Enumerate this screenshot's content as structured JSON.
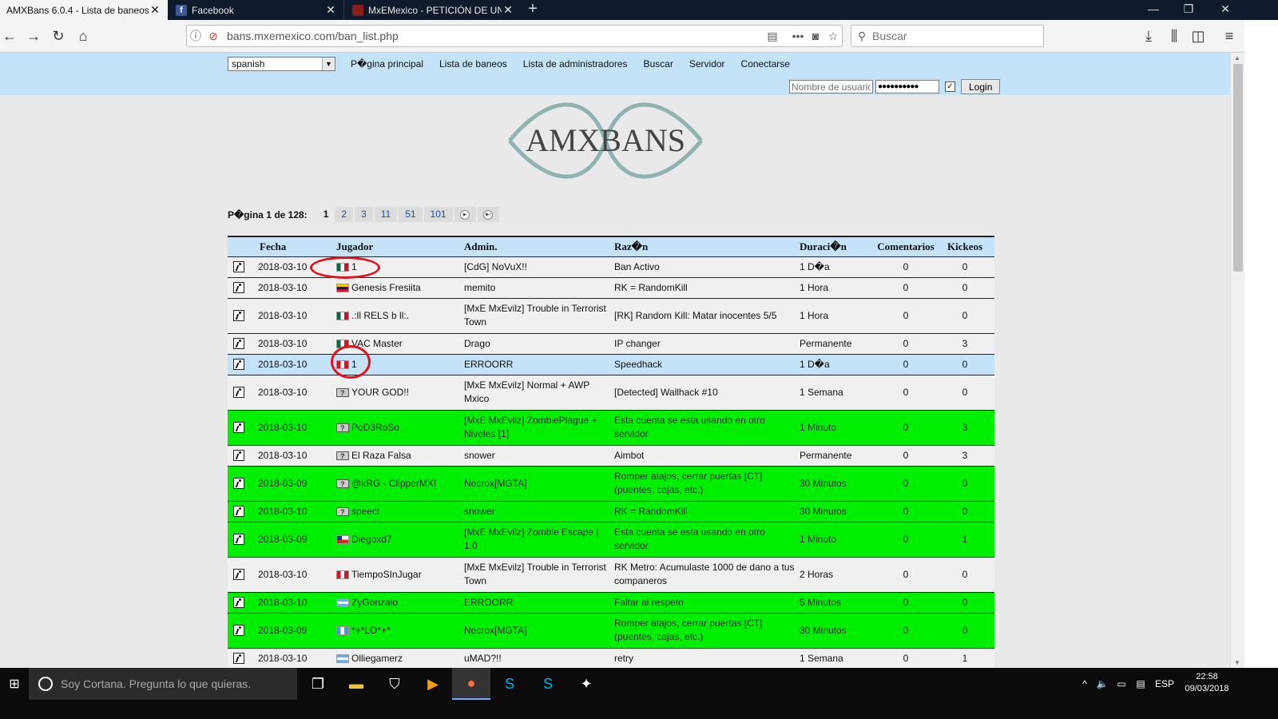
{
  "browser": {
    "tabs": [
      {
        "title": "AMXBans 6.0.4 - Lista de baneos",
        "active": true,
        "favicon": "amxbans-icon"
      },
      {
        "title": "Facebook",
        "active": false,
        "favicon": "facebook-icon"
      },
      {
        "title": "MxEMexico - PETICIÓN DE UNE",
        "active": false,
        "favicon": "mxemexico-icon"
      }
    ],
    "url": "bans.mxemexico.com/ban_list.php",
    "search_placeholder": "Buscar"
  },
  "site": {
    "language": "spanish",
    "menu": [
      "P�gina principal",
      "Lista de baneos",
      "Lista de administradores",
      "Buscar",
      "Servidor",
      "Conectarse"
    ],
    "login": {
      "username_placeholder": "Nombre de usuario",
      "password_mask": "●●●●●●●●●●",
      "button": "Login"
    },
    "logo_text": "AMXBANS"
  },
  "pager": {
    "label": "P�gina 1 de 128:",
    "current": "1",
    "pages": [
      "2",
      "3",
      "11",
      "51",
      "101"
    ],
    "next_icon": "next-page-icon",
    "last_icon": "last-page-icon"
  },
  "table": {
    "headers": [
      "Fecha",
      "Jugador",
      "Admin.",
      "Raz�n",
      "Duraci�n",
      "Comentarios",
      "Kickeos"
    ],
    "rows": [
      {
        "date": "2018-03-10",
        "flag": "mx",
        "player": "1",
        "admin": "[CdG] NoVuX!!",
        "reason": "Ban Activo",
        "duration": "1 D�a",
        "comments": "0",
        "kicks": "0",
        "style": "r"
      },
      {
        "date": "2018-03-10",
        "flag": "ve",
        "player": "Genesis Fresiita",
        "admin": "memito",
        "reason": "RK = RandomKill",
        "duration": "1 Hora",
        "comments": "0",
        "kicks": "0",
        "style": "r"
      },
      {
        "date": "2018-03-10",
        "flag": "mx",
        "player": ".:ll RELS b ll:.",
        "admin": "[MxE MxEvilz] Trouble in Terrorist Town",
        "reason": "[RK] Random Kill: Matar inocentes 5/5",
        "duration": "1 Hora",
        "comments": "0",
        "kicks": "0",
        "style": "r"
      },
      {
        "date": "2018-03-10",
        "flag": "mx",
        "player": "VAC Master",
        "admin": "Drago",
        "reason": "IP changer",
        "duration": "Permanente",
        "comments": "0",
        "kicks": "3",
        "style": "r"
      },
      {
        "date": "2018-03-10",
        "flag": "pe",
        "player": "1",
        "admin": "ERROORR",
        "reason": "Speedhack",
        "duration": "1 D�a",
        "comments": "0",
        "kicks": "0",
        "style": "sel"
      },
      {
        "date": "2018-03-10",
        "flag": "unk",
        "player": "YOUR GOD!!",
        "admin": "[MxE MxEvilz] Normal + AWP Mxico",
        "reason": "[Detected] Wallhack #10",
        "duration": "1 Semana",
        "comments": "0",
        "kicks": "0",
        "style": "r"
      },
      {
        "date": "2018-03-10",
        "flag": "unk",
        "player": "PoD3RoSo",
        "admin": "[MxE MxEvilz] ZombiePlague + Niveles [1]",
        "reason": "Esta cuenta se esta usando en otro servidor",
        "duration": "1 Minuto",
        "comments": "0",
        "kicks": "3",
        "style": "grn"
      },
      {
        "date": "2018-03-10",
        "flag": "unk",
        "player": "El Raza Falsa",
        "admin": "snower",
        "reason": "Aimbot",
        "duration": "Permanente",
        "comments": "0",
        "kicks": "3",
        "style": "r"
      },
      {
        "date": "2018-03-09",
        "flag": "unk",
        "player": "@kRG - ClipperMX!",
        "admin": "Necrox[MGTA]",
        "reason": "Romper atajos, cerrar puertas [CT] (puentes, cajas, etc.)",
        "duration": "30 Minutos",
        "comments": "0",
        "kicks": "0",
        "style": "grn"
      },
      {
        "date": "2018-03-10",
        "flag": "unk",
        "player": "speect",
        "admin": "snower",
        "reason": "RK = RandomKill",
        "duration": "30 Minutos",
        "comments": "0",
        "kicks": "0",
        "style": "grn"
      },
      {
        "date": "2018-03-09",
        "flag": "cl",
        "player": "Diegoxd7",
        "admin": "[MxE MxEvilz] Zombie Escape | 1.0",
        "reason": "Esta cuenta se esta usando en otro servidor",
        "duration": "1 Minuto",
        "comments": "0",
        "kicks": "1",
        "style": "grn"
      },
      {
        "date": "2018-03-10",
        "flag": "pe",
        "player": "TiempoSInJugar",
        "admin": "[MxE MxEvilz] Trouble in Terrorist Town",
        "reason": "RK Metro: Acumulaste 1000 de dano a tus companeros",
        "duration": "2 Horas",
        "comments": "0",
        "kicks": "0",
        "style": "r"
      },
      {
        "date": "2018-03-10",
        "flag": "ar",
        "player": "ZyGonzalo",
        "admin": "ERROORR",
        "reason": "Faltar al respeto",
        "duration": "5 Minutos",
        "comments": "0",
        "kicks": "0",
        "style": "grn"
      },
      {
        "date": "2018-03-09",
        "flag": "gt",
        "player": "*+*LO*+*",
        "admin": "Necrox[MGTA]",
        "reason": "Romper atajos, cerrar puertas [CT] (puentes, cajas, etc.)",
        "duration": "30 Minutos",
        "comments": "0",
        "kicks": "0",
        "style": "grn"
      },
      {
        "date": "2018-03-10",
        "flag": "ar",
        "player": "Olliegamerz",
        "admin": "uMAD?!!",
        "reason": "retry",
        "duration": "1 Semana",
        "comments": "0",
        "kicks": "1",
        "style": "r"
      }
    ]
  },
  "taskbar": {
    "search_text": "Soy Cortana. Pregunta lo que quieras.",
    "language": "ESP",
    "time": "22:58",
    "date": "09/03/2018"
  },
  "colors": {
    "page_bg": "#e9e9e9",
    "header_blue": "#c4e3f9",
    "highlight_green": "#00ee00",
    "annotation_red": "#e0141e"
  }
}
